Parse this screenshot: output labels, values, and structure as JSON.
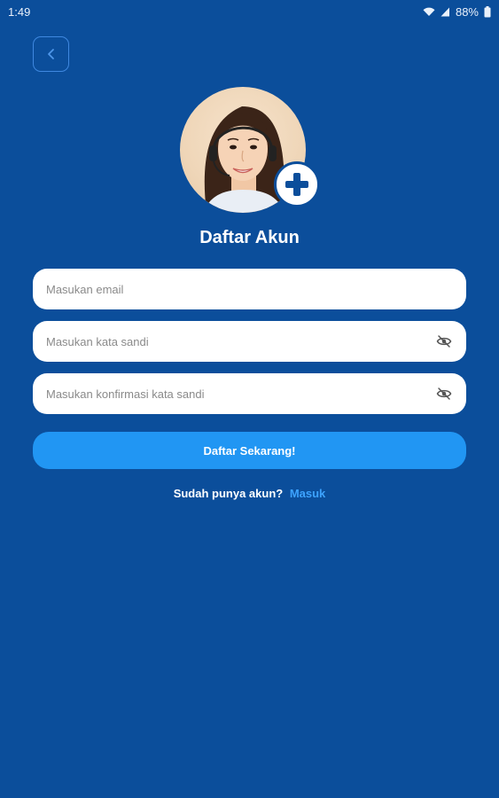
{
  "status_bar": {
    "time": "1:49",
    "battery": "88%"
  },
  "header": {
    "title": "Daftar Akun"
  },
  "form": {
    "email_placeholder": "Masukan email",
    "password_placeholder": "Masukan kata sandi",
    "confirm_placeholder": "Masukan konfirmasi kata sandi",
    "submit_label": "Daftar Sekarang!"
  },
  "footer": {
    "prompt": "Sudah punya akun?",
    "login_label": "Masuk"
  },
  "icons": {
    "back": "chevron-left-icon",
    "add_photo": "plus-icon",
    "visibility": "eye-off-icon"
  },
  "colors": {
    "background": "#0b4e9b",
    "primary_button": "#2196f3",
    "link": "#3da3ff"
  }
}
